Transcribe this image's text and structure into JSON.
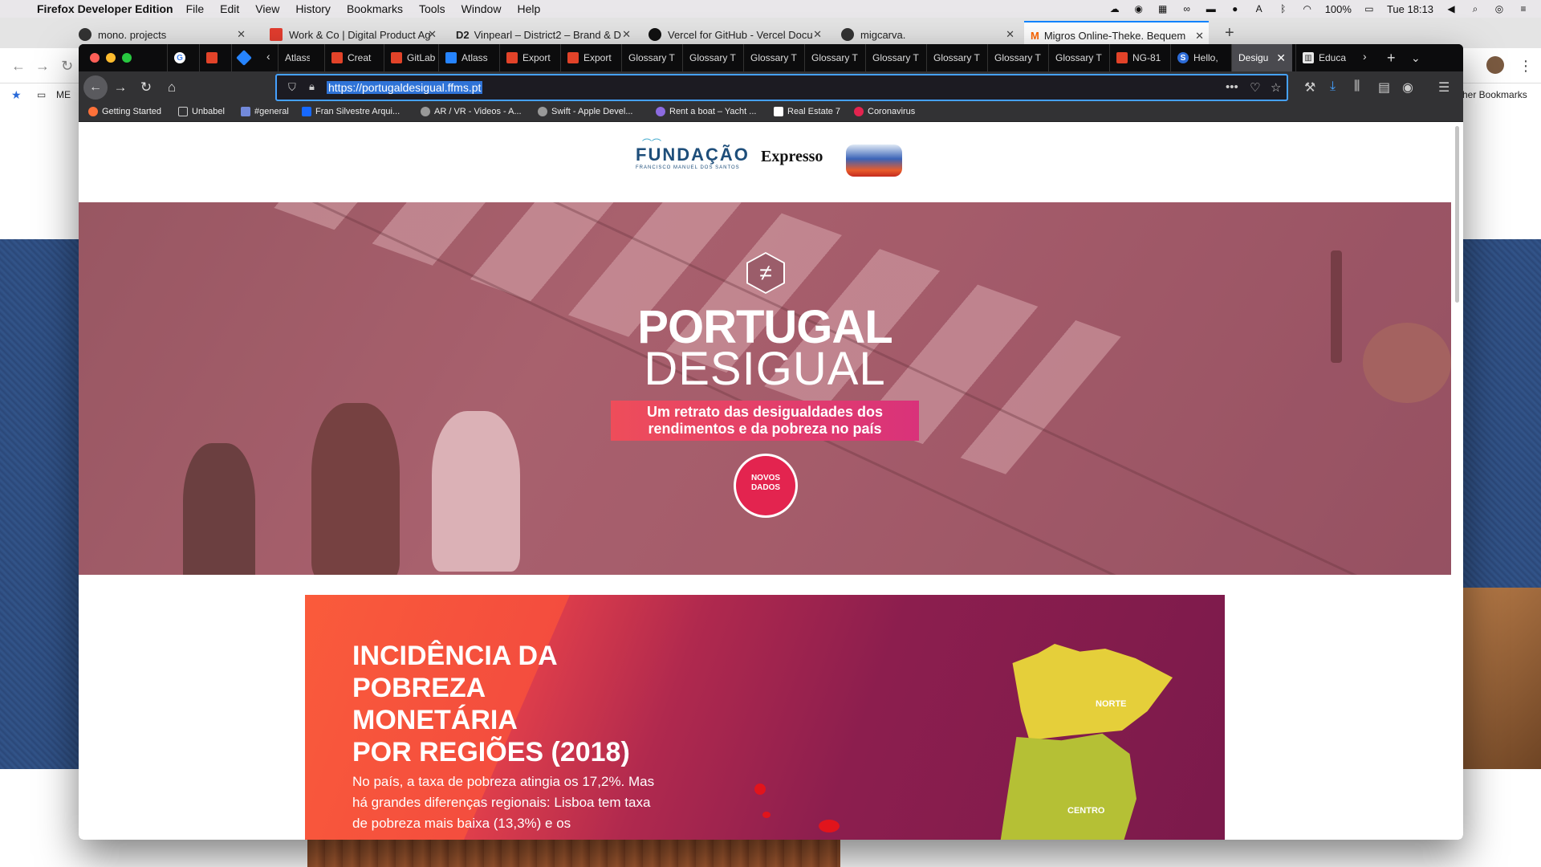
{
  "menubar": {
    "app_name": "Firefox Developer Edition",
    "items": [
      "File",
      "Edit",
      "View",
      "History",
      "Bookmarks",
      "Tools",
      "Window",
      "Help"
    ],
    "battery": "100%",
    "clock": "Tue 18:13"
  },
  "bg_window": {
    "tabs": [
      {
        "title": "mono. projects"
      },
      {
        "title": "Work & Co | Digital Product Ag"
      },
      {
        "title": "Vinpearl – District2 – Brand & D"
      },
      {
        "title": "Vercel for GitHub - Vercel Docu"
      },
      {
        "title": "migcarva."
      },
      {
        "title": "Migros Online-Theke. Bequem"
      }
    ],
    "bookmark_first": "ME",
    "bookmark_right": "her Bookmarks"
  },
  "dev_window": {
    "tabs": [
      {
        "title": "",
        "fav": "G"
      },
      {
        "title": "",
        "fav": "gitlab"
      },
      {
        "title": "",
        "fav": "jira"
      },
      {
        "title": "Atlass"
      },
      {
        "title": "Creat"
      },
      {
        "title": "GitLab"
      },
      {
        "title": "Atlass"
      },
      {
        "title": "Export"
      },
      {
        "title": "Export"
      },
      {
        "title": "Glossary T"
      },
      {
        "title": "Glossary T"
      },
      {
        "title": "Glossary T"
      },
      {
        "title": "Glossary T"
      },
      {
        "title": "Glossary T"
      },
      {
        "title": "Glossary T"
      },
      {
        "title": "Glossary T"
      },
      {
        "title": "Glossary T"
      },
      {
        "title": "NG-81"
      },
      {
        "title": "Hello,"
      },
      {
        "title": "Desigu"
      },
      {
        "title": "Educa"
      }
    ],
    "url": "https://portugaldesigual.ffms.pt",
    "bookmarks": [
      "Getting Started",
      "Unbabel",
      "#general",
      "Fran Silvestre Arqui...",
      "AR / VR - Videos - A...",
      "Swift - Apple Devel...",
      "Rent a boat – Yacht ...",
      "Real Estate 7",
      "Coronavirus"
    ]
  },
  "page": {
    "logos": {
      "fundacao": "FUNDAÇÃO",
      "fundacao_sub": "FRANCISCO MANUEL DOS SANTOS",
      "expresso": "Expresso"
    },
    "hero": {
      "symbol": "≠",
      "title_line1": "PORTUGAL",
      "title_line2": "DESIGUAL",
      "subtitle_line1": "Um retrato das desigualdades dos",
      "subtitle_line2": "rendimentos e da pobreza no país",
      "badge_line1": "NOVOS",
      "badge_line2": "DADOS"
    },
    "card": {
      "title_line1": "INCIDÊNCIA DA",
      "title_line2": "POBREZA",
      "title_line3": "MONETÁRIA",
      "title_line4": "POR REGIÕES (2018)",
      "text": "No país, a taxa de pobreza atingia os 17,2%. Mas há grandes diferenças regionais: Lisboa tem taxa de pobreza mais baixa (13,3%) e os",
      "regions": [
        "NORTE",
        "CENTRO"
      ]
    }
  }
}
